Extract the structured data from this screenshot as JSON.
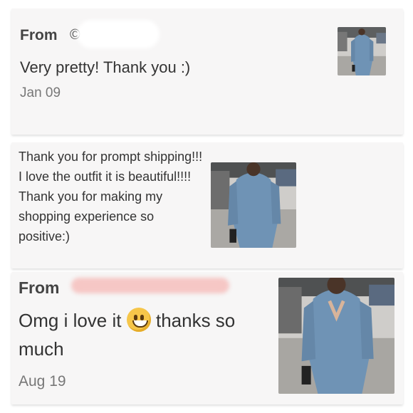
{
  "reviews": [
    {
      "from_label": "From",
      "message": "Very pretty! Thank you :)",
      "date": "Jan 09",
      "photo_icon": "photo-thumbnail"
    },
    {
      "message": "Thank you for prompt shipping!!! I love the outfit it is beautiful!!!! Thank you for making my shopping experience so positive:)",
      "photo_icon": "photo-thumbnail"
    },
    {
      "from_label": "From",
      "message_part1": "Omg i love it",
      "message_part2": "thanks so much",
      "emoji_icon": "grinning-face-emoji",
      "date": "Aug 19",
      "photo_icon": "photo-thumbnail"
    }
  ],
  "colors": {
    "card_background": "#f7f6f6",
    "sweater_blue": "#6f93b5",
    "redaction_pink": "#f6c7c5"
  }
}
